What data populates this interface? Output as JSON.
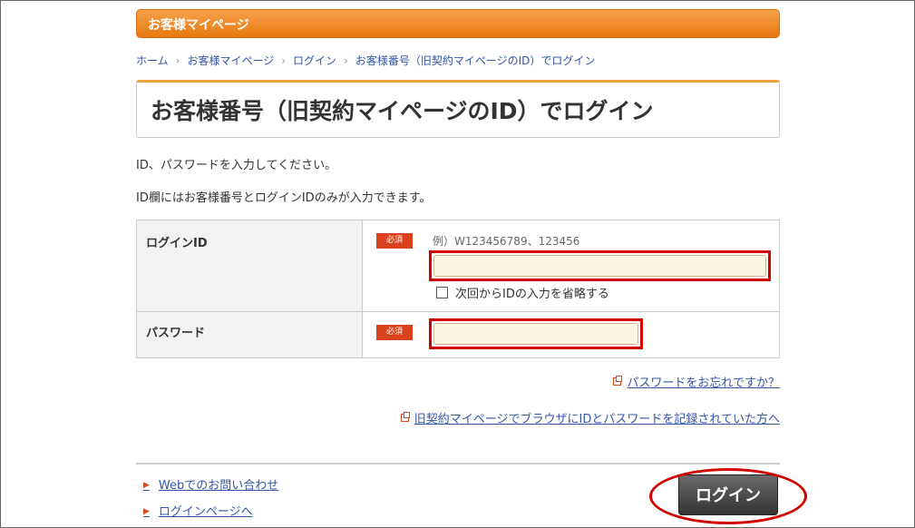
{
  "header": {
    "title": "お客様マイページ"
  },
  "breadcrumb": [
    {
      "label": "ホーム"
    },
    {
      "label": "お客様マイページ"
    },
    {
      "label": "ログイン"
    },
    {
      "label": "お客様番号（旧契約マイページのID）でログイン"
    }
  ],
  "page_title": "お客様番号（旧契約マイページのID）でログイン",
  "instructions": {
    "line1": "ID、パスワードを入力してください。",
    "line2": "ID欄にはお客様番号とログインIDのみが入力できます。"
  },
  "form": {
    "login_id": {
      "label": "ログインID",
      "required_badge": "必須",
      "hint": "例）W123456789、123456",
      "value": "",
      "remember_label": "次回からIDの入力を省略する",
      "remember_checked": false
    },
    "password": {
      "label": "パスワード",
      "required_badge": "必須",
      "value": ""
    }
  },
  "links": {
    "forgot_password": "パスワードをお忘れですか？",
    "old_mypage": "旧契約マイページでブラウザにIDとパスワードを記録されていた方へ"
  },
  "footer_links": [
    {
      "label": "Webでのお問い合わせ"
    },
    {
      "label": "ログインページへ"
    }
  ],
  "login_button": "ログイン",
  "colors": {
    "accent": "#ee8a25",
    "required_badge": "#d9421c",
    "highlight": "#d40000",
    "link": "#3355aa"
  }
}
